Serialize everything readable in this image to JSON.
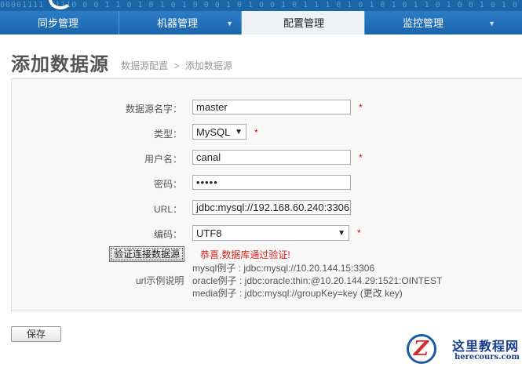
{
  "header": {
    "bits": "00001111 11110 0 0 1 1 0 1 0 1 0 1 0 0 0 1 0 1 0 0 1 0 1 1 1 0 1 0 1 0 1 0 1 1 0 1 0 0 1 0 1 0 1 1 0 0 1 0 1",
    "brand_color": "#1b66a8"
  },
  "nav": {
    "items": [
      {
        "label": "同步管理",
        "active": false
      },
      {
        "label": "机器管理",
        "active": false
      },
      {
        "label": "配置管理",
        "active": true
      },
      {
        "label": "监控管理",
        "active": false
      }
    ],
    "caret": "▼"
  },
  "page": {
    "title": "添加数据源",
    "breadcrumb": [
      "数据源配置",
      ">",
      "添加数据源"
    ]
  },
  "form": {
    "name_label": "数据源名字：",
    "name_value": "master",
    "type_label": "类型：",
    "type_value": "MySQL",
    "user_label": "用户名：",
    "user_value": "canal",
    "password_label": "密码：",
    "password_value": "•••••",
    "url_label": "URL：",
    "url_value": "jdbc:mysql://192.168.60.240:3306",
    "encoding_label": "编码：",
    "encoding_value": "UTF8",
    "required_mark": "*",
    "required_color": "#e00000",
    "select_arrow": "▼"
  },
  "verify": {
    "button_label": "验证连接数据源",
    "result_text": "恭喜,数据库通过验证!",
    "result_color": "#d9231a"
  },
  "examples": {
    "label": "url示例说明",
    "lines": [
      "mysql例子 : jdbc:mysql://10.20.144.15:3306",
      "oracle例子 : jdbc:oracle:thin:@10.20.144.29:1521:OINTEST",
      "media例子 : jdbc:mysql://groupKey=key (更改 key)"
    ]
  },
  "save_button": "保存",
  "watermark": {
    "logo_letter": "Z",
    "title": "这里教程网",
    "url": "herecours.com"
  }
}
